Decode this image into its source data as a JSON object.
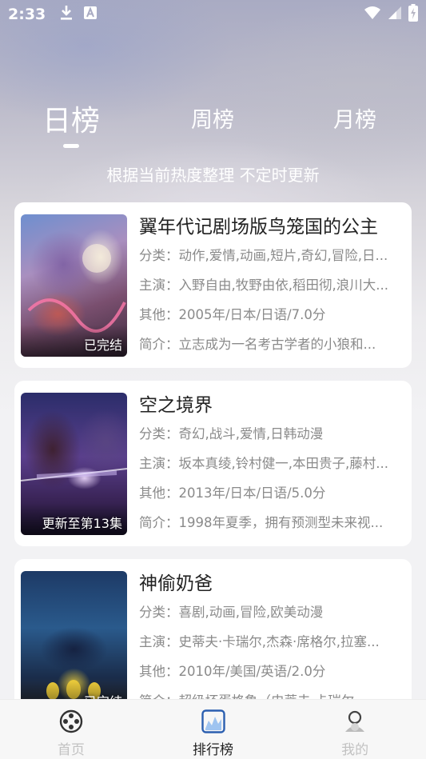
{
  "status": {
    "time": "2:33",
    "icons_left": [
      "download-icon",
      "a-icon"
    ],
    "icons_right": [
      "wifi-icon",
      "signal-icon",
      "battery-charging-icon"
    ]
  },
  "tabs": [
    {
      "label": "日榜",
      "active": true
    },
    {
      "label": "周榜",
      "active": false
    },
    {
      "label": "月榜",
      "active": false
    }
  ],
  "subtitle": "根据当前热度整理 不定时更新",
  "items": [
    {
      "title": "翼年代记剧场版鸟笼国的公主",
      "category": "分类：动作,爱情,动画,短片,奇幻,冒险,日...",
      "cast": "主演：入野自由,牧野由依,稻田彻,浪川大...",
      "other": "其他：2005年/日本/日语/7.0分",
      "intro": "简介：立志成为一名考古学者的小狼和...",
      "badge": "已完结"
    },
    {
      "title": "空之境界",
      "category": "分类：奇幻,战斗,爱情,日韩动漫",
      "cast": "主演：坂本真绫,铃村健一,本田贵子,藤村...",
      "other": "其他：2013年/日本/日语/5.0分",
      "intro": "简介：1998年夏季，拥有预测型未来视...",
      "badge": "更新至第13集"
    },
    {
      "title": "神偷奶爸",
      "category": "分类：喜剧,动画,冒险,欧美动漫",
      "cast": "主演：史蒂夫·卡瑞尔,杰森·席格尔,拉塞...",
      "other": "其他：2010年/美国/英语/2.0分",
      "intro": "简介：超级坏蛋格鲁（史蒂夫·卡瑞尔 ...",
      "badge": "已完结"
    }
  ],
  "nav": [
    {
      "label": "首页",
      "icon": "film-reel-icon",
      "active": false
    },
    {
      "label": "排行榜",
      "icon": "chart-icon",
      "active": true
    },
    {
      "label": "我的",
      "icon": "profile-icon",
      "active": false
    }
  ]
}
